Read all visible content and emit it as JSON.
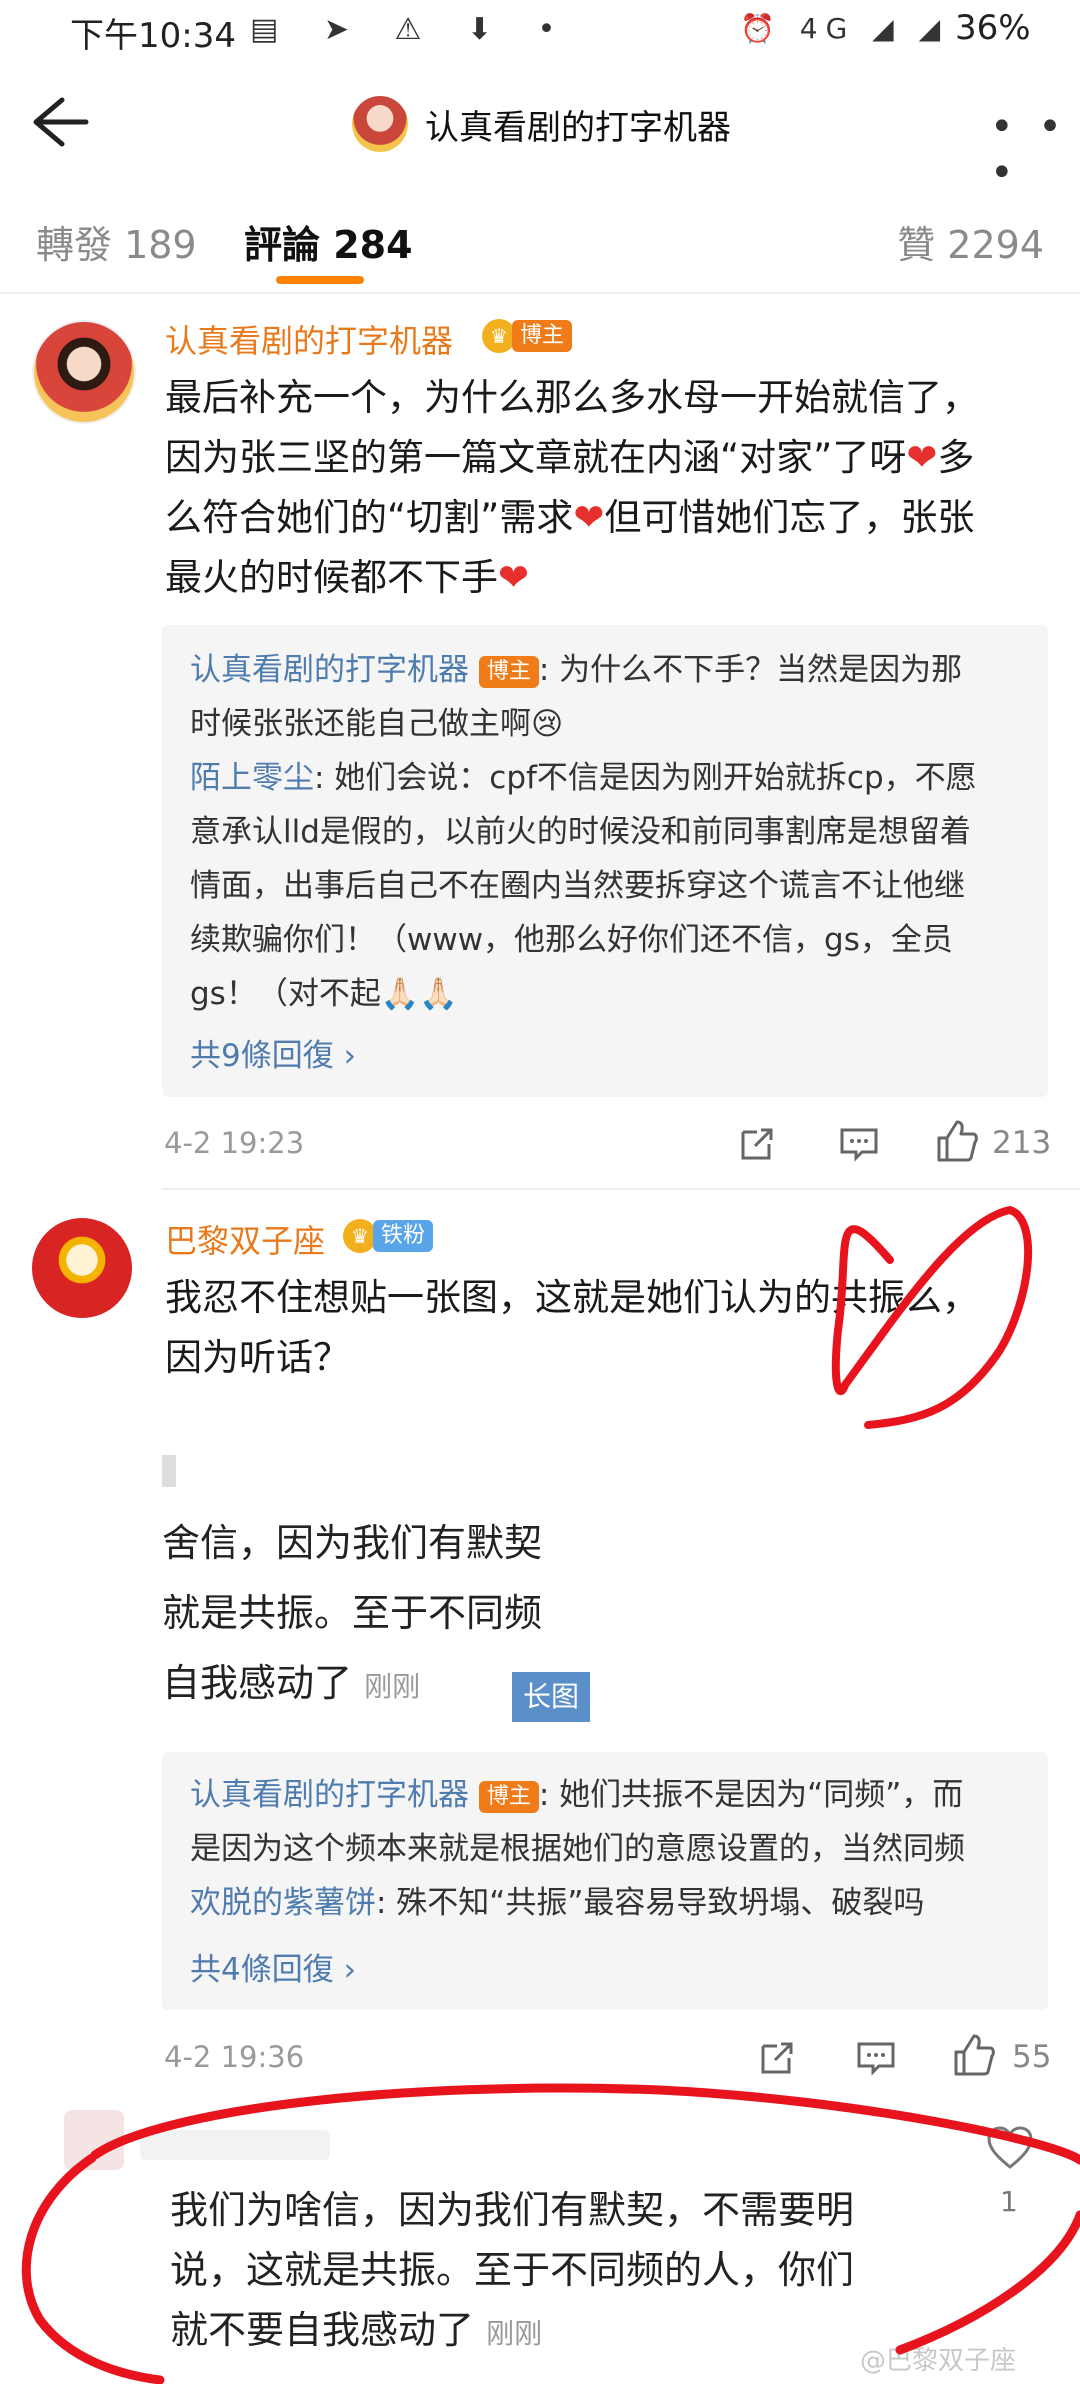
{
  "status": {
    "time": "下午10:34",
    "network": "4G",
    "battery": "36%"
  },
  "nav": {
    "title": "认真看剧的打字机器"
  },
  "tabs": {
    "forward": "轉發 189",
    "comments": "評論 284",
    "likes": "贊 2294"
  },
  "comments": [
    {
      "username": "认真看剧的打字机器",
      "badge": "博主",
      "text_lines": [
        "最后补充一个，为什么那么多水母一开始就信了，",
        "因为张三坚的第一篇文章就在内涵“对家”了呀",
        "么符合她们的“切割”需求",
        "最火的时候都不下手"
      ],
      "text_tail": {
        "l2": "多",
        "l3": "但可惜她们忘了，张张"
      },
      "replies": [
        {
          "name": "认真看剧的打字机器",
          "tag": "博主",
          "text": ": 为什么不下手？当然是因为那",
          "text2": "时候张张还能自己做主啊😢"
        },
        {
          "name": "陌上零尘",
          "text": ": 她们会说：cpf不信是因为刚开始就拆cp，不愿",
          "text2": "意承认lld是假的，以前火的时候没和前同事割席是想留着",
          "text3": "情面，出事后自己不在圈内当然要拆穿这个谎言不让他继",
          "text4": "续欺骗你们！（www，他那么好你们还不信，gs，全员",
          "text5": "gs！（对不起🙏🏻🙏🏻"
        }
      ],
      "replies_more": "共9條回復 ›",
      "time": "4-2 19:23",
      "likes": "213"
    },
    {
      "username": "巴黎双子座",
      "badge": "铁粉",
      "text_lines": [
        "我忍不住想贴一张图，这就是她们认为的共振么，",
        "因为听话？"
      ],
      "image_lines": [
        "舍信，因为我们有默契",
        "就是共振。至于不同频",
        "自我感动了"
      ],
      "image_time": "刚刚",
      "long_image": "长图",
      "replies": [
        {
          "name": "认真看剧的打字机器",
          "tag": "博主",
          "text": ": 她们共振不是因为“同频”，而",
          "text2": "是因为这个频本来就是根据她们的意愿设置的，当然同频"
        },
        {
          "name": "欢脱的紫薯饼",
          "text": ": 殊不知“共振”最容易导致坍塌、破裂吗"
        }
      ],
      "replies_more": "共4條回復 ›",
      "time": "4-2 19:36",
      "likes": "55"
    }
  ],
  "highlight": {
    "lines": [
      "我们为啥信，因为我们有默契，不需要明",
      "说，这就是共振。至于不同频的人，你们",
      "就不要自我感动了"
    ],
    "time": "刚刚",
    "like_count": "1"
  },
  "watermark": "@巴黎双子座",
  "accent_color": "#ff8200"
}
